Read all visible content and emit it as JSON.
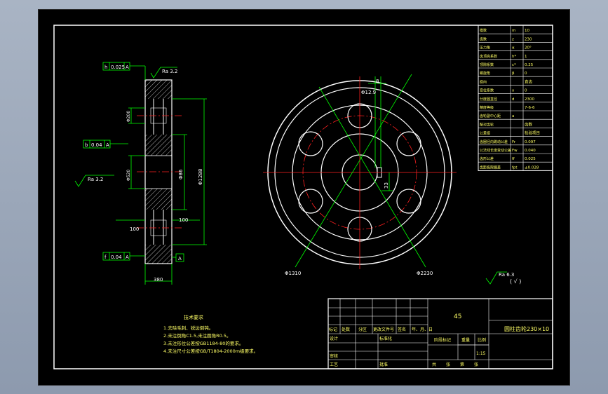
{
  "colors": {
    "background": "#000000",
    "outline": "#ffffff",
    "dimension": "#00ff00",
    "centerline": "#ff2020",
    "note_text": "#ffff66"
  },
  "side_view": {
    "roughness_top": "Ra 3.2",
    "roughness_left": "Ra 3.2",
    "tol_top": {
      "sym": "h",
      "value": "0.025",
      "datum": "A"
    },
    "tol_mid": {
      "sym": "b",
      "value": "0.04",
      "datum": "A"
    },
    "tol_bot": {
      "sym": "f",
      "value": "0.04",
      "datum": "A"
    },
    "datum_label": "A",
    "dims": {
      "width_bottom": "380",
      "left_100": "100",
      "right_100": "100",
      "d_hub": "Φ86",
      "d_outer": "Φ1288",
      "d_bore": "Φ200",
      "d_mid": "Φ520"
    }
  },
  "front_view": {
    "keyway_width": "8",
    "keyway_label": "Φ12.9",
    "keyway_depth": "33",
    "label_left": "Φ1310",
    "label_right": "Φ2230"
  },
  "surface_note": {
    "text": "Ra 6.3",
    "paren": "( √ )"
  },
  "param_table": [
    [
      "模数",
      "m",
      "10"
    ],
    [
      "齿数",
      "z",
      "230"
    ],
    [
      "压力角",
      "α",
      "20°"
    ],
    [
      "齿顶高系数",
      "h*",
      "1"
    ],
    [
      "顶隙系数",
      "c*",
      "0.25"
    ],
    [
      "螺旋角",
      "β",
      "0"
    ],
    [
      "旋向",
      "",
      "直齿"
    ],
    [
      "变位系数",
      "x",
      "0"
    ],
    [
      "分度圆直径",
      "d",
      "2300"
    ],
    [
      "精度等级",
      "",
      "7-6-6"
    ],
    [
      "齿轮副中心距",
      "a",
      ""
    ],
    [
      "配对齿轮",
      "",
      "齿数"
    ],
    [
      "公差组",
      "",
      "检验项目"
    ],
    [
      "齿圈径向跳动公差",
      "Fr",
      "0.097"
    ],
    [
      "公法线长度变动公差",
      "Fw",
      "0.040"
    ],
    [
      "齿形公差",
      "ff",
      "0.025"
    ],
    [
      "齿距极限偏差",
      "fpt",
      "±0.028"
    ]
  ],
  "tech_req": {
    "title": "技术要求",
    "items": [
      "1.去除毛刺、锐边倒钝。",
      "2.未注倒角C1.5,未注圆角R0.5。",
      "3.未注形位公差按GB1184-80的要求。",
      "4.未注尺寸公差按GB/T1804-2000m级要求。"
    ]
  },
  "title_block": {
    "material": "45",
    "drawing_name": "圆柱齿轮230×10",
    "labels": [
      "标记",
      "处数",
      "分区",
      "更改文件号",
      "签名",
      "年、月、日"
    ],
    "row_design": [
      "设计",
      "",
      "标准化"
    ],
    "row_check": [
      "审核"
    ],
    "row_process": [
      "工艺",
      "",
      "批准"
    ],
    "stage_label": "阶段标记",
    "weight_label": "重量",
    "scale_label": "比例",
    "scale_value": "1:15",
    "sheet_info": [
      "共",
      "张",
      "第",
      "张"
    ]
  }
}
